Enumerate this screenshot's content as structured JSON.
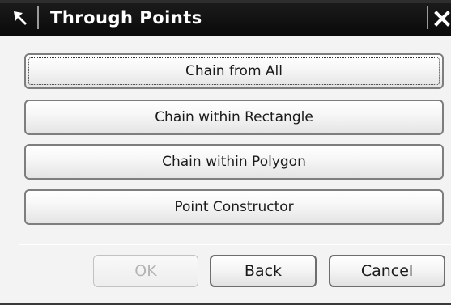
{
  "window": {
    "title": "Through Points",
    "title_icon": "arrow-cursor-icon",
    "close_icon": "close-icon",
    "close_symbol": "✕"
  },
  "actions": [
    {
      "label": "Chain from All",
      "focused": true
    },
    {
      "label": "Chain within Rectangle",
      "focused": false
    },
    {
      "label": "Chain within Polygon",
      "focused": false
    },
    {
      "label": "Point Constructor",
      "focused": false
    }
  ],
  "footer": {
    "ok_label": "OK",
    "ok_enabled": false,
    "back_label": "Back",
    "cancel_label": "Cancel"
  },
  "colors": {
    "titlebar": "#111111",
    "title_text": "#ffffff",
    "body": "#f3f3f3",
    "button_border": "#7e7e7e",
    "disabled_text": "#b4b4b4"
  }
}
